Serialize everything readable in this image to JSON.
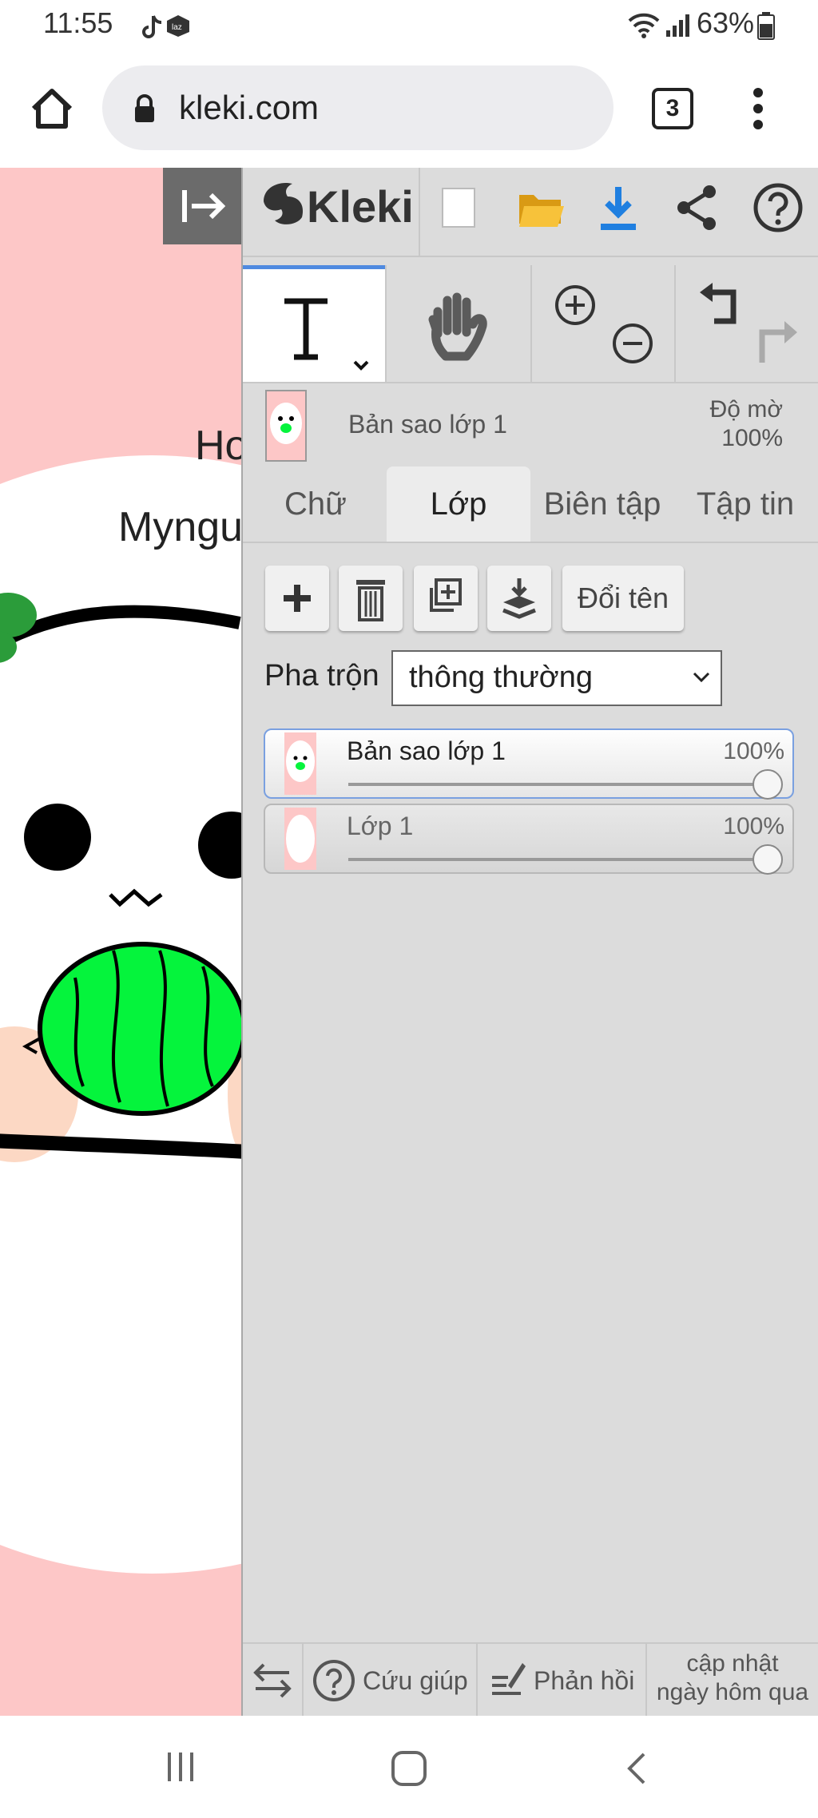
{
  "status_bar": {
    "time": "11:55",
    "battery": "63%"
  },
  "browser": {
    "url": "kleki.com",
    "tab_count": "3"
  },
  "canvas": {
    "visible_text": [
      "Ho",
      "Myngu"
    ]
  },
  "app": {
    "logo": "Kleki"
  },
  "layer_header": {
    "layer_name": "Bản sao lớp 1",
    "opacity_label": "Độ mờ",
    "opacity_value": "100%"
  },
  "tabs": [
    {
      "label": "Chữ"
    },
    {
      "label": "Lớp",
      "active": true
    },
    {
      "label": "Biên tập"
    },
    {
      "label": "Tập tin"
    }
  ],
  "layer_controls": {
    "rename_label": "Đổi tên",
    "blend_label": "Pha trộn",
    "blend_value": "thông thường"
  },
  "layers": [
    {
      "name": "Bản sao lớp 1",
      "opacity": "100%",
      "selected": true
    },
    {
      "name": "Lớp 1",
      "opacity": "100%",
      "selected": false
    }
  ],
  "bottom_bar": {
    "help_label": "Cứu giúp",
    "feedback_label": "Phản hồi",
    "update_line1": "cập nhật",
    "update_line2": "ngày hôm qua"
  },
  "colors": {
    "accent_blue": "#4f8ae0",
    "download_blue": "#1f7fe0",
    "folder_yellow": "#f3b21d",
    "canvas_pink": "#fdc7c7",
    "melon_green": "#05f43c"
  }
}
